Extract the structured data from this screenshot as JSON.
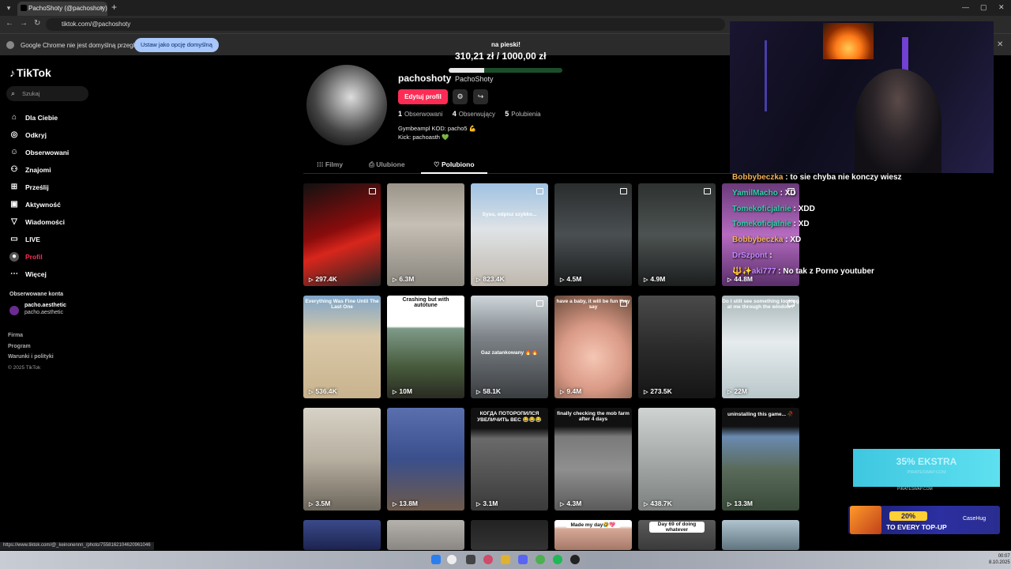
{
  "browser": {
    "tab_title": "PachoShoty (@pachoshoty)",
    "url": "tiktok.com/@pachoshoty",
    "infobar_text": "Google Chrome nie jest domyślną przeglądarką",
    "infobar_button": "Ustaw jako opcję domyślną",
    "status_url": "https://www.tiktok.com/@_keinonennn_/photo/7558162104620961046"
  },
  "tiktok": {
    "logo": "TikTok",
    "search_placeholder": "Szukaj",
    "nav": [
      {
        "label": "Dla Ciebie",
        "icon": "home-icon",
        "glyph": "⌂"
      },
      {
        "label": "Odkryj",
        "icon": "compass-icon",
        "glyph": "◎"
      },
      {
        "label": "Obserwowani",
        "icon": "following-icon",
        "glyph": "☺"
      },
      {
        "label": "Znajomi",
        "icon": "friends-icon",
        "glyph": "⚇"
      },
      {
        "label": "Prześlij",
        "icon": "upload-icon",
        "glyph": "⊞"
      },
      {
        "label": "Aktywność",
        "icon": "activity-icon",
        "glyph": "▣"
      },
      {
        "label": "Wiadomości",
        "icon": "messages-icon",
        "glyph": "▽"
      },
      {
        "label": "LIVE",
        "icon": "live-icon",
        "glyph": "▭"
      },
      {
        "label": "Profil",
        "icon": "profile-icon",
        "glyph": "●"
      },
      {
        "label": "Więcej",
        "icon": "more-icon",
        "glyph": "⋯"
      }
    ],
    "followed_title": "Obserwowane konta",
    "followed": [
      {
        "name": "pacho.aesthetic",
        "nick": "pacho.aesthetic"
      }
    ],
    "footer": {
      "firma": "Firma",
      "program": "Program",
      "terms": "Warunki i polityki",
      "copy": "© 2025 TikTok"
    }
  },
  "profile": {
    "username": "pachoshoty",
    "nickname": "PachoShoty",
    "edit_button": "Edytuj profil",
    "following_count": "1",
    "following_label": "Obserwowani",
    "followers_count": "4",
    "followers_label": "Obserwujący",
    "likes_count": "5",
    "likes_label": "Polubienia",
    "bio_line1": "Gymbeampl KOD: pacho5 💪",
    "bio_line2": "Kick: pachoasth 💚",
    "tabs": [
      {
        "label": "Filmy",
        "glyph": "⁞⁞⁞"
      },
      {
        "label": "Ulubione",
        "glyph": "⎙"
      },
      {
        "label": "Polubiono",
        "glyph": "♡"
      }
    ]
  },
  "goal": {
    "title": "na pieski!",
    "current": "310,21 zł",
    "target": "1000,00 zł",
    "progress": 0.31
  },
  "videos": [
    {
      "views": "297.4K",
      "caption": "",
      "multi": true,
      "bg": "linear-gradient(160deg,#111 0%,#8a0c0c 45%,#d8261c 60%,#222 100%)"
    },
    {
      "views": "6.3M",
      "caption": "",
      "multi": false,
      "bg": "linear-gradient(180deg,#9a9388 0%,#c5bfb5 40%,#8a857d 100%)"
    },
    {
      "views": "823.4K",
      "caption": "Sysu, odpisz szybko...",
      "multi": true,
      "bg": "linear-gradient(180deg,#9fc2e2 0%,#dfe3e6 45%,#bfb7ad 100%)"
    },
    {
      "views": "4.5M",
      "caption": "",
      "multi": true,
      "bg": "linear-gradient(180deg,#2a2d2d 0%,#4a4f52 50%,#1a1c1c 100%)"
    },
    {
      "views": "4.9M",
      "caption": "",
      "multi": true,
      "bg": "linear-gradient(180deg,#2d3230 0%,#4d5352 50%,#1c1e1e 100%)"
    },
    {
      "views": "44.8M",
      "caption": "",
      "multi": true,
      "bg": "linear-gradient(180deg,#6a3a7a 0%,#b56bc0 50%,#5a2f6a 100%)"
    },
    {
      "views": "536.4K",
      "caption": "Everything Was Fine Until The Last One",
      "multi": false,
      "bg": "linear-gradient(180deg,#7fa6c9 0%,#d9c8a7 40%,#c9b38e 100%)"
    },
    {
      "views": "10M",
      "caption": "Crashing but with autotune",
      "multi": false,
      "bg": "linear-gradient(180deg,#fff 0%,#fff 30%,#7f9a8a 32%,#465a3a 70%,#2a2a22 100%)"
    },
    {
      "views": "58.1K",
      "caption": "Gaz zatankowany 🔥🔥",
      "multi": true,
      "bg": "linear-gradient(180deg,#cfd6db 0%,#7d8388 40%,#3a3d40 100%)"
    },
    {
      "views": "9.4M",
      "caption": "have a baby, it will be fun they say",
      "multi": true,
      "bg": "radial-gradient(circle at 50% 60%,#f5c6b4 0%,#d99a86 45%,#6a4a3a 100%)"
    },
    {
      "views": "273.5K",
      "caption": "",
      "multi": false,
      "bg": "linear-gradient(180deg,#4a4a4a 0%,#2b2b2b 50%,#151515 100%)"
    },
    {
      "views": "22M",
      "caption": "Do I still see something looking at me through the window?",
      "multi": true,
      "bg": "linear-gradient(180deg,#a7b4b8 0%,#e6ecee 45%,#b9c7cb 100%)"
    },
    {
      "views": "3.5M",
      "caption": "",
      "multi": false,
      "bg": "linear-gradient(180deg,#d7d2c6 0%,#b7afa0 50%,#6d665c 100%)"
    },
    {
      "views": "13.8M",
      "caption": "",
      "multi": false,
      "bg": "linear-gradient(180deg,#5a6fae 0%,#3a4f8c 50%,#6e5a4a 100%)"
    },
    {
      "views": "3.1M",
      "caption": "КОГДА ПОТОРОПИЛСЯ УВЕЛИЧИТЬ ВЕС 😂😂😂",
      "multi": false,
      "bg": "linear-gradient(180deg,#111 0%,#111 20%,#6a6a6a 30%,#3a3a3a 100%)"
    },
    {
      "views": "4.3M",
      "caption": "finally checking the mob farm after 4 days",
      "multi": false,
      "bg": "linear-gradient(180deg,#111 0%,#111 18%,#7a7a7a 28%,#8f8f8f 60%,#5a5a5a 100%)"
    },
    {
      "views": "438.7K",
      "caption": "",
      "multi": false,
      "bg": "linear-gradient(180deg,#cfd3d2 0%,#a6aba9 50%,#7c807e 100%)"
    },
    {
      "views": "13.3M",
      "caption": "uninstalling this game... 🥀",
      "multi": false,
      "bg": "linear-gradient(180deg,#111 0%,#111 18%,#6a8ab0 28%,#5a6a5a 60%,#3a4a3a 100%)"
    },
    {
      "views": "",
      "caption": "",
      "multi": false,
      "bg": "linear-gradient(180deg,#3a4a8a 0%,#1c2350 100%)"
    },
    {
      "views": "",
      "caption": "",
      "multi": false,
      "bg": "linear-gradient(180deg,#b5b2ad 0%,#8a8783 100%)"
    },
    {
      "views": "",
      "caption": "",
      "multi": false,
      "bg": "linear-gradient(180deg,#222 0%,#333 100%)"
    },
    {
      "views": "",
      "caption": "Made my day🤣💖",
      "multi": false,
      "bg": "linear-gradient(180deg,#fff 0%,#fff 20%,#d6a896 30%,#a57868 100%)"
    },
    {
      "views": "",
      "caption": "Day 69 of doing whatever",
      "multi": false,
      "bg": "linear-gradient(180deg,#5a5a5a 0%,#3a3a3a 100%)"
    },
    {
      "views": "",
      "caption": "",
      "multi": false,
      "bg": "linear-gradient(180deg,#b0c4d0 0%,#607580 100%)"
    }
  ],
  "chat": [
    {
      "user": "Bobbybeczka",
      "color": "#f2b25c",
      "text": "to sie chyba nie konczy wiesz"
    },
    {
      "user": "YamilMacho",
      "color": "#2fd0a8",
      "text": "XD"
    },
    {
      "user": "Tomekoficjalnie",
      "color": "#2fd0a8",
      "text": "XDD"
    },
    {
      "user": "Tomekoficjalnie",
      "color": "#2fd0a8",
      "text": "XD"
    },
    {
      "user": "Bobbybeczka",
      "color": "#f2b25c",
      "text": "XD"
    },
    {
      "user": "DrSzpont",
      "color": "#c287ff",
      "text": ""
    },
    {
      "user": "🔱✨aki777",
      "color": "#c287ff",
      "text": "No tak z Porno youtuber"
    }
  ],
  "ads": {
    "ad1_big": "35% EKSTRA",
    "ad1_sub": "PIRATESWAP.COM",
    "ad1_label": "PIRATESWAP.COM",
    "ad2_pill": "20% EXTRA",
    "ad2_text": "TO EVERY TOP-UP",
    "ad2_brand": "CaseHug"
  },
  "taskbar": {
    "time": "00:07",
    "date": "8.10.2025"
  }
}
